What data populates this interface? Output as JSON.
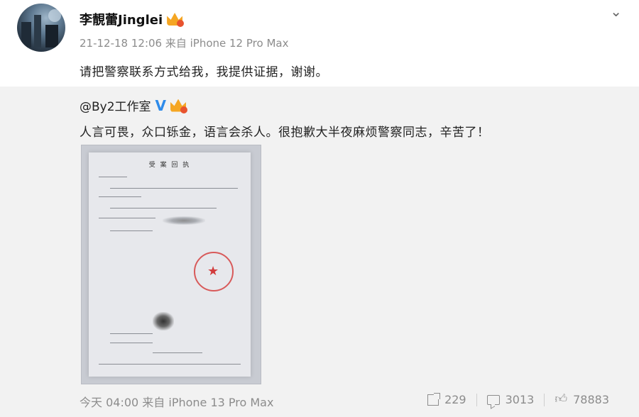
{
  "post": {
    "author": "李靚蕾Jinglei",
    "meta": "21-12-18 12:06 来自 iPhone 12 Pro Max",
    "content": "请把警察联系方式给我，我提供证据，谢谢。"
  },
  "repost": {
    "author": "@By2工作室",
    "content": "人言可畏，众口铄金，语言会杀人。很抱歉大半夜麻烦警察同志，辛苦了！",
    "document": {
      "title": "受 案 回 执"
    },
    "time": "今天 04:00 来自 iPhone 13 Pro Max",
    "stats": {
      "reposts": "229",
      "comments": "3013",
      "likes": "78883"
    }
  },
  "colors": {
    "verified_blue": "#2e8bea",
    "vip_gold": "#f5a623",
    "stamp_red": "#d23c3c"
  },
  "icons": [
    "chevron-down-icon",
    "vip-badge-icon",
    "verified-icon",
    "repost-icon",
    "comment-icon",
    "like-icon"
  ]
}
